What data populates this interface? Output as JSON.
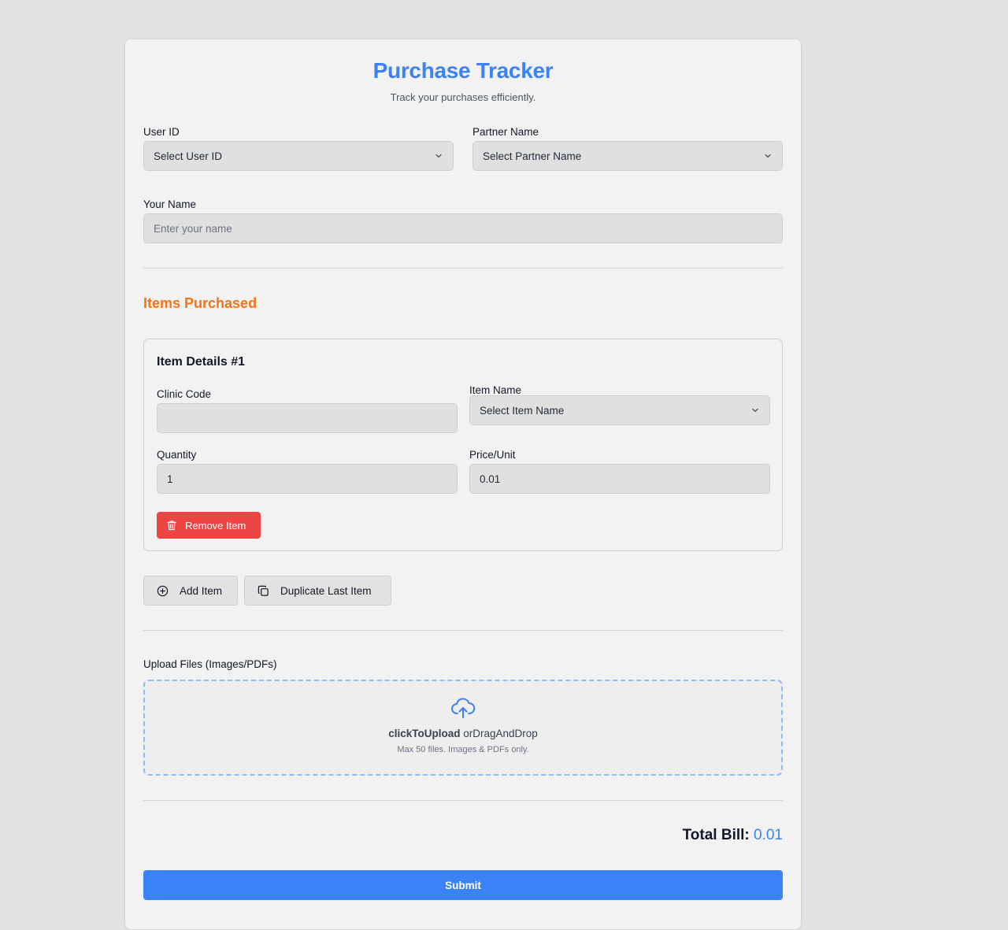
{
  "header": {
    "title": "Purchase Tracker",
    "subtitle": "Track your purchases efficiently."
  },
  "form": {
    "user_id": {
      "label": "User ID",
      "value": "Select User ID"
    },
    "partner_name": {
      "label": "Partner Name",
      "value": "Select Partner Name"
    },
    "your_name": {
      "label": "Your Name",
      "placeholder": "Enter your name",
      "value": ""
    }
  },
  "items_section": {
    "title": "Items Purchased",
    "items": [
      {
        "title": "Item Details #1",
        "clinic_code": {
          "label": "Clinic Code",
          "value": ""
        },
        "item_name": {
          "label": "Item Name",
          "value": "Select Item Name"
        },
        "quantity": {
          "label": "Quantity",
          "value": "1"
        },
        "price_unit": {
          "label": "Price/Unit",
          "value": "0.01"
        },
        "remove_label": "Remove Item"
      }
    ],
    "add_item_label": "Add Item",
    "duplicate_label": "Duplicate Last Item"
  },
  "upload": {
    "label": "Upload Files (Images/PDFs)",
    "click_text": "clickToUpload",
    "drag_text": "orDragAndDrop",
    "hint": "Max 50 files. Images & PDFs only."
  },
  "total": {
    "label": "Total Bill:",
    "value": "0.01"
  },
  "submit_label": "Submit",
  "colors": {
    "accent": "#3b82f6",
    "section": "#f97316",
    "danger": "#ef4444"
  },
  "icons": [
    "chevron-down-icon",
    "trash-icon",
    "plus-circle-icon",
    "copy-icon",
    "cloud-upload-icon"
  ]
}
